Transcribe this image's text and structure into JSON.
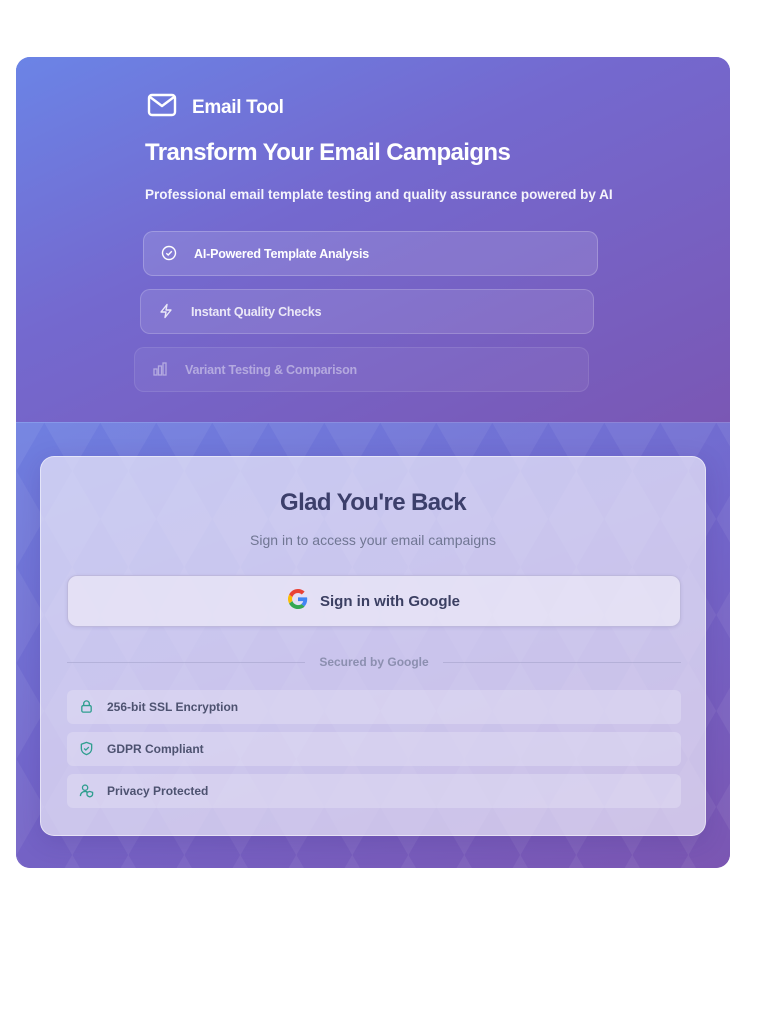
{
  "brand": {
    "name": "Email Tool",
    "icon": "mail-icon"
  },
  "hero": {
    "title": "Transform Your Email Campaigns",
    "subtitle": "Professional email template testing and quality assurance powered by AI",
    "features": [
      {
        "label": "AI-Powered Template Analysis",
        "icon": "check-circle-icon"
      },
      {
        "label": "Instant Quality Checks",
        "icon": "lightning-icon"
      },
      {
        "label": "Variant Testing & Comparison",
        "icon": "bar-chart-icon"
      }
    ]
  },
  "login": {
    "title": "Glad You're Back",
    "subtitle": "Sign in to access your email campaigns",
    "google_button": "Sign in with Google",
    "divider_label": "Secured by Google",
    "security": [
      {
        "label": "256-bit SSL Encryption",
        "icon": "lock-icon"
      },
      {
        "label": "GDPR Compliant",
        "icon": "shield-check-icon"
      },
      {
        "label": "Privacy Protected",
        "icon": "user-shield-icon"
      }
    ]
  },
  "colors": {
    "accent_teal": "#2f9e8f",
    "google_blue": "#4285F4",
    "google_red": "#EA4335",
    "google_yellow": "#FBBC05",
    "google_green": "#34A853"
  }
}
